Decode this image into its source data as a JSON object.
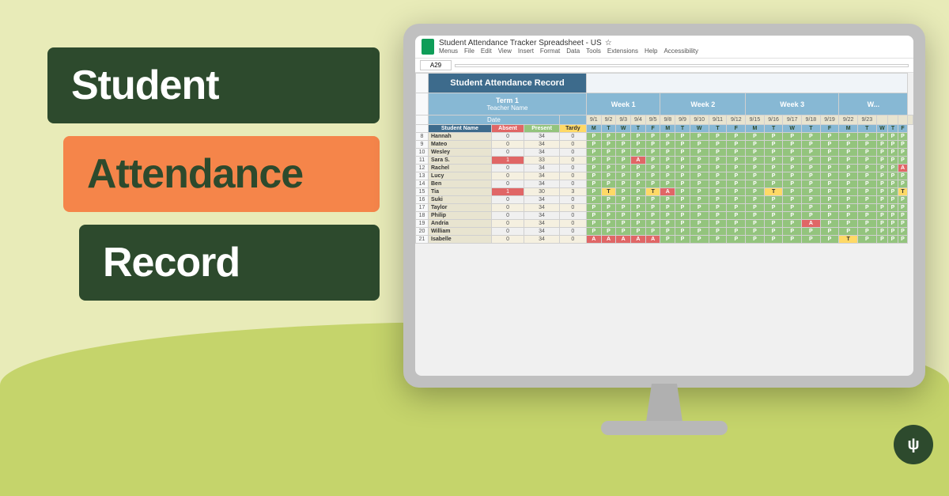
{
  "background": {
    "main_color": "#e8ebb8",
    "hill_color": "#c5d46b"
  },
  "left_panel": {
    "line1": "Student",
    "line2": "Attendance",
    "line3": "Record"
  },
  "spreadsheet": {
    "title": "Student Attendance Tracker Spreadsheet - US",
    "menu_items": [
      "Menus",
      "File",
      "Edit",
      "View",
      "Insert",
      "Format",
      "Data",
      "Tools",
      "Extensions",
      "Help",
      "Accessibility"
    ],
    "header_title": "Student Attendance Record",
    "term": "Term 1",
    "teacher": "Teacher Name",
    "weeks": [
      "Week 1",
      "Week 2",
      "Week 3"
    ],
    "date_label": "Date",
    "col_headers": [
      "Student Name",
      "Absent",
      "Present",
      "Tardy"
    ],
    "day_headers": [
      "M",
      "T",
      "W",
      "T",
      "F",
      "M",
      "T",
      "W",
      "T",
      "F",
      "M",
      "T",
      "W",
      "T",
      "F",
      "M",
      "T",
      "W",
      "T",
      "F"
    ],
    "date_codes": [
      "9/1",
      "9/2",
      "9/3",
      "9/4",
      "9/5",
      "9/8",
      "9/9",
      "9/10",
      "9/11",
      "9/12",
      "9/15",
      "9/16",
      "9/17",
      "9/18",
      "9/19",
      "9/22",
      "9/23"
    ],
    "students": [
      {
        "name": "Hannah",
        "absent": 0,
        "present": 34,
        "tardy": 0
      },
      {
        "name": "Mateo",
        "absent": 0,
        "present": 34,
        "tardy": 0
      },
      {
        "name": "Wesley",
        "absent": 0,
        "present": 34,
        "tardy": 0
      },
      {
        "name": "Sara S.",
        "absent": 1,
        "present": 33,
        "tardy": 0
      },
      {
        "name": "Rachel",
        "absent": 0,
        "present": 34,
        "tardy": 0
      },
      {
        "name": "Lucy",
        "absent": 0,
        "present": 34,
        "tardy": 0
      },
      {
        "name": "Ben",
        "absent": 0,
        "present": 34,
        "tardy": 0
      },
      {
        "name": "Tia",
        "absent": 1,
        "present": 30,
        "tardy": 3
      },
      {
        "name": "Suki",
        "absent": 0,
        "present": 34,
        "tardy": 0
      },
      {
        "name": "Taylor",
        "absent": 0,
        "present": 34,
        "tardy": 0
      },
      {
        "name": "Philip",
        "absent": 0,
        "present": 34,
        "tardy": 0
      },
      {
        "name": "Andria",
        "absent": 0,
        "present": 34,
        "tardy": 0
      },
      {
        "name": "William",
        "absent": 0,
        "present": 34,
        "tardy": 0
      },
      {
        "name": "Isabelle",
        "absent": 0,
        "present": 34,
        "tardy": 0
      }
    ]
  },
  "badge": {
    "symbol": "ψ"
  }
}
